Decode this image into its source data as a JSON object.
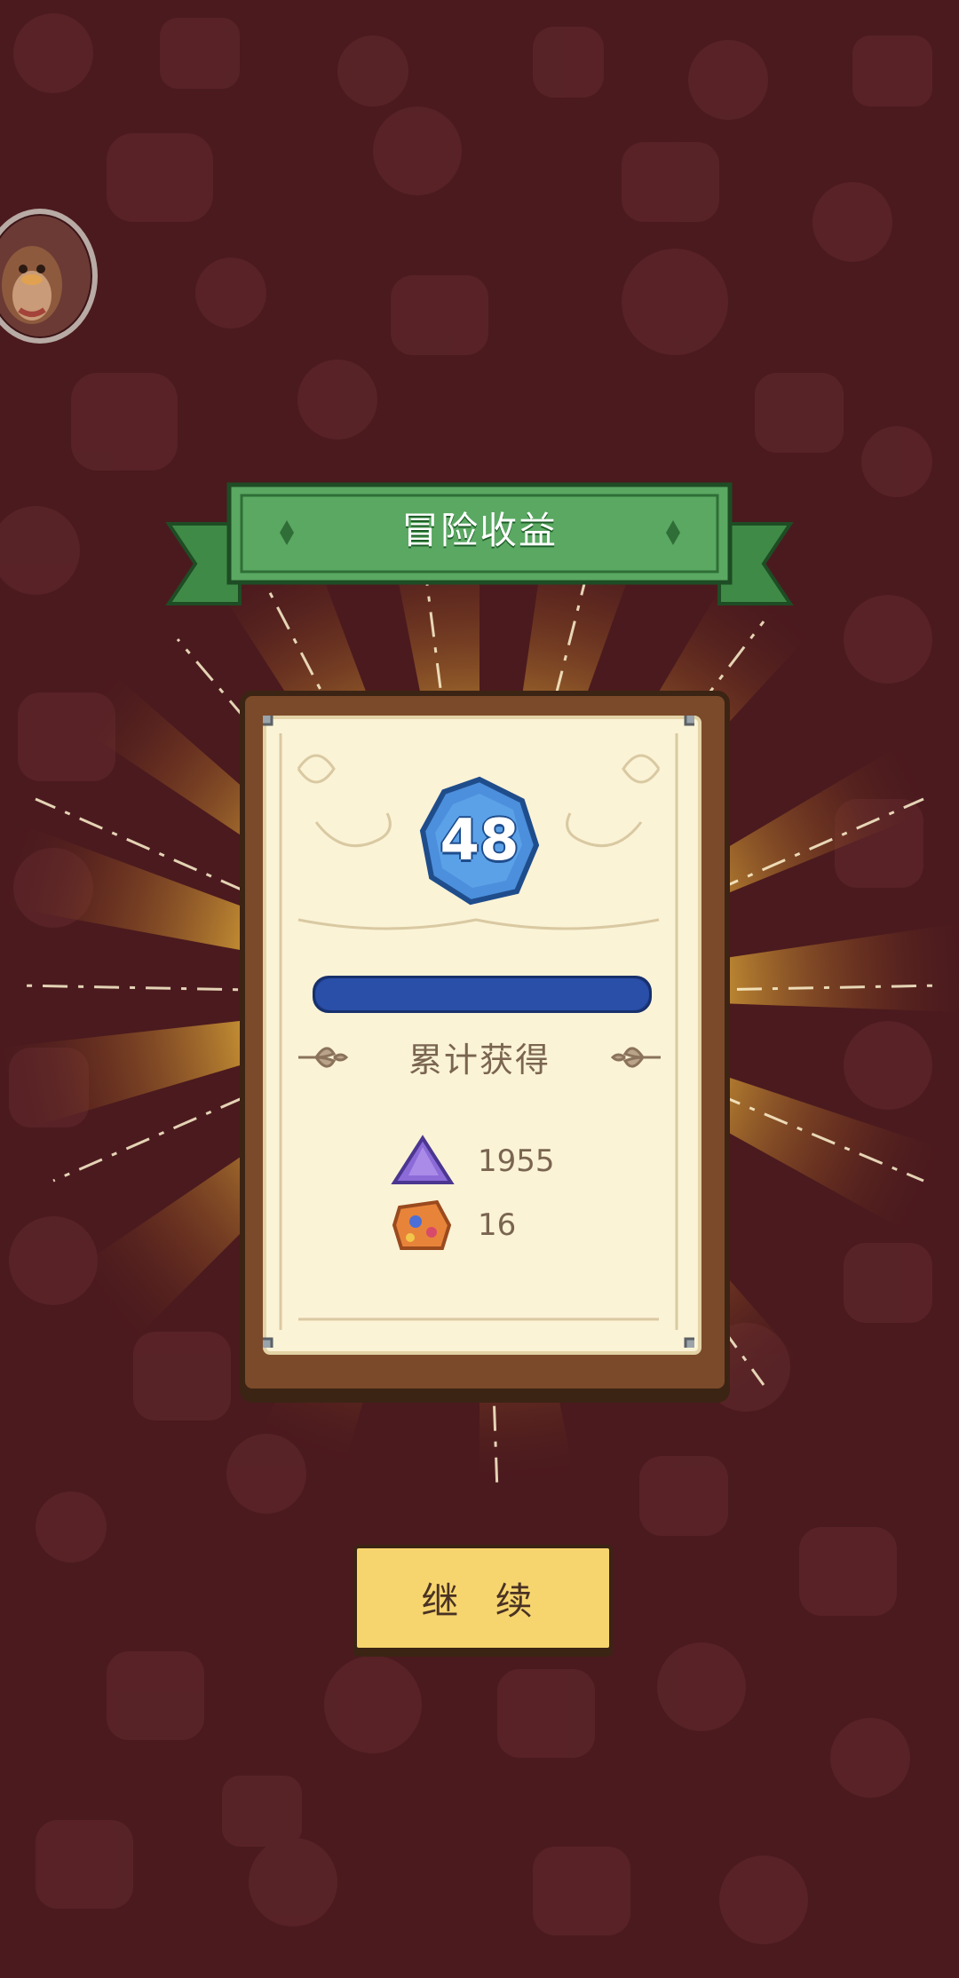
{
  "header": {
    "title": "冒险收益"
  },
  "level": {
    "value": "48"
  },
  "progress": {
    "fraction": 1.0
  },
  "summary": {
    "label": "累计获得",
    "rewards": [
      {
        "icon": "purple-crystal-icon",
        "count": "1955"
      },
      {
        "icon": "orange-gem-icon",
        "count": "16"
      }
    ]
  },
  "actions": {
    "continue_label": "继 续"
  },
  "colors": {
    "background": "#4b1a1e",
    "ribbon": "#4f9b55",
    "badge": "#4c8fdc",
    "progress": "#20408f",
    "button": "#f6d56f",
    "paper": "#fbf3d6"
  }
}
